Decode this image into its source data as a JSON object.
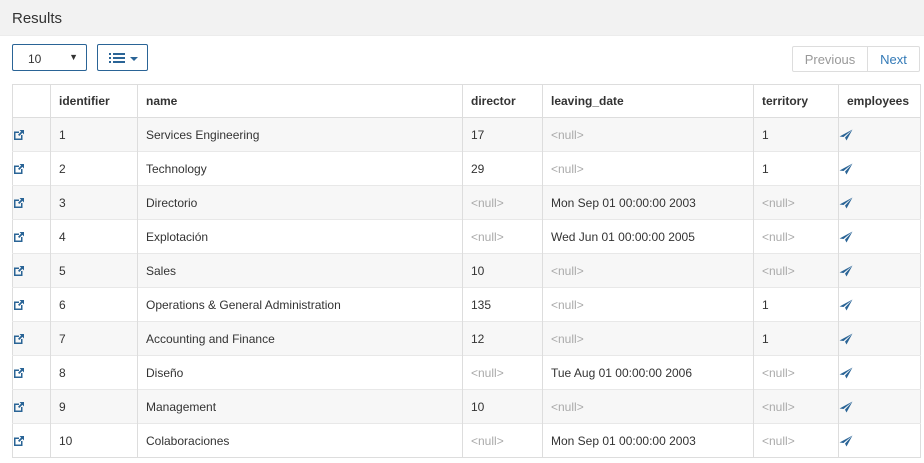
{
  "panel": {
    "title": "Results"
  },
  "toolbar": {
    "page_size": "10",
    "pager": {
      "previous": "Previous",
      "next": "Next"
    }
  },
  "colors": {
    "accent": "#2a6496",
    "link": "#337ab7",
    "null_text": "#aaaaaa"
  },
  "table": {
    "columns": [
      "",
      "identifier",
      "name",
      "director",
      "leaving_date",
      "territory",
      "employees"
    ],
    "null_label": "<null>",
    "rows": [
      {
        "identifier": "1",
        "name": "Services Engineering",
        "director": "17",
        "leaving_date": null,
        "territory": "1"
      },
      {
        "identifier": "2",
        "name": "Technology",
        "director": "29",
        "leaving_date": null,
        "territory": "1"
      },
      {
        "identifier": "3",
        "name": "Directorio",
        "director": null,
        "leaving_date": "Mon Sep 01 00:00:00 2003",
        "territory": null
      },
      {
        "identifier": "4",
        "name": "Explotación",
        "director": null,
        "leaving_date": "Wed Jun 01 00:00:00 2005",
        "territory": null
      },
      {
        "identifier": "5",
        "name": "Sales",
        "director": "10",
        "leaving_date": null,
        "territory": null
      },
      {
        "identifier": "6",
        "name": "Operations & General Administration",
        "director": "135",
        "leaving_date": null,
        "territory": "1"
      },
      {
        "identifier": "7",
        "name": "Accounting and Finance",
        "director": "12",
        "leaving_date": null,
        "territory": "1"
      },
      {
        "identifier": "8",
        "name": "Diseño",
        "director": null,
        "leaving_date": "Tue Aug 01 00:00:00 2006",
        "territory": null
      },
      {
        "identifier": "9",
        "name": "Management",
        "director": "10",
        "leaving_date": null,
        "territory": null
      },
      {
        "identifier": "10",
        "name": "Colaboraciones",
        "director": null,
        "leaving_date": "Mon Sep 01 00:00:00 2003",
        "territory": null
      }
    ]
  }
}
